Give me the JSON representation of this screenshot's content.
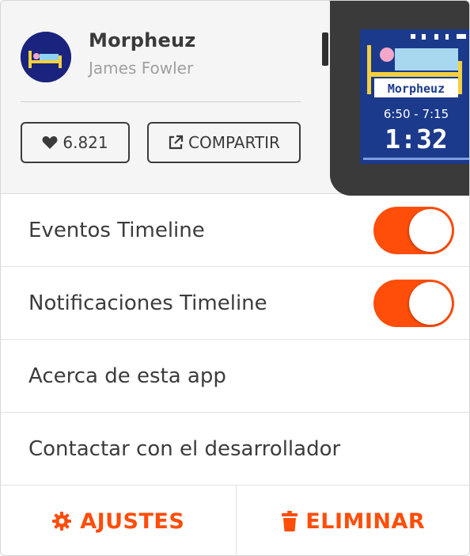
{
  "app": {
    "name": "Morpheuz",
    "author": "James Fowler",
    "icon": "bed-icon"
  },
  "actions": {
    "likes_count": "6.821",
    "like_icon": "heart-icon",
    "share_label": "COMPARTIR",
    "share_icon": "external-link-icon"
  },
  "watch_screen": {
    "title": "Morpheuz",
    "window": "6:50 - 7:15",
    "time": "1:32"
  },
  "settings": [
    {
      "label": "Eventos Timeline",
      "toggle": true,
      "enabled": true
    },
    {
      "label": "Notificaciones Timeline",
      "toggle": true,
      "enabled": true
    },
    {
      "label": "Acerca de esta app",
      "toggle": false
    },
    {
      "label": "Contactar con el desarrollador",
      "toggle": false
    }
  ],
  "footer": {
    "settings_label": "AJUSTES",
    "settings_icon": "gear-icon",
    "delete_label": "ELIMINAR",
    "delete_icon": "trash-icon"
  },
  "colors": {
    "accent": "#ff4d0a",
    "watch_screen_bg": "#1b3a8c"
  }
}
